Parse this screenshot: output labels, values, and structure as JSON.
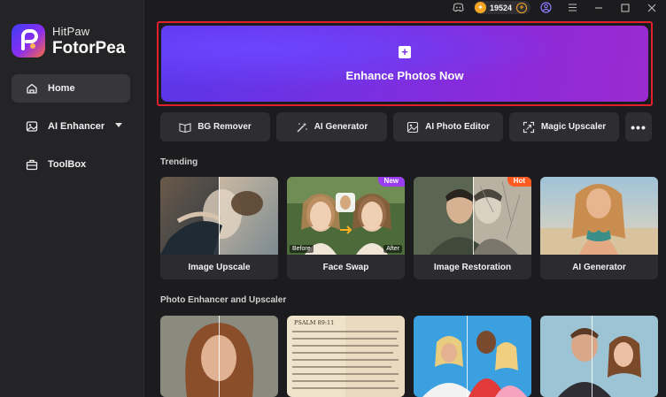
{
  "brand": {
    "top": "HitPaw",
    "main": "FotorPea",
    "logo_icon": "fotorpea-logo-icon"
  },
  "sidebar": {
    "items": [
      {
        "label": "Home",
        "icon": "home-icon",
        "active": true
      },
      {
        "label": "AI Enhancer",
        "icon": "image-ai-icon",
        "has_caret": true
      },
      {
        "label": "ToolBox",
        "icon": "toolbox-icon"
      }
    ]
  },
  "titlebar": {
    "coins": "19524",
    "icons": [
      "discord-icon",
      "coin-icon",
      "add-coins-icon",
      "account-icon",
      "menu-icon",
      "minimize-icon",
      "maximize-icon",
      "close-icon"
    ]
  },
  "hero": {
    "label": "Enhance Photos Now",
    "icon": "plus-icon"
  },
  "tools": [
    {
      "label": "BG Remover",
      "icon": "bg-remover-icon"
    },
    {
      "label": "AI Generator",
      "icon": "magic-wand-icon"
    },
    {
      "label": "AI Photo Editor",
      "icon": "photo-editor-icon"
    },
    {
      "label": "Magic Upscaler",
      "icon": "upscale-icon"
    },
    {
      "label": "•••",
      "icon": "more-icon"
    }
  ],
  "sections": {
    "trending": "Trending",
    "photo_enhancer": "Photo Enhancer and Upscaler"
  },
  "trending_cards": [
    {
      "label": "Image Upscale",
      "badge": ""
    },
    {
      "label": "Face Swap",
      "badge": "New",
      "before": "Before",
      "after": "After"
    },
    {
      "label": "Image Restoration",
      "badge": "Hot"
    },
    {
      "label": "AI Generator",
      "badge": ""
    }
  ],
  "enhancer_cards": [
    {
      "name": "portrait-card"
    },
    {
      "name": "document-card",
      "text": "PSALM 89:11"
    },
    {
      "name": "group-photo-card"
    },
    {
      "name": "couple-photo-card"
    }
  ],
  "colors": {
    "accent_purple": "#7a2fe0",
    "highlight_red": "#e0202c",
    "badge_new": "#9a3cf0",
    "badge_hot": "#ff5a1f",
    "coin_gold": "#f4a623"
  }
}
